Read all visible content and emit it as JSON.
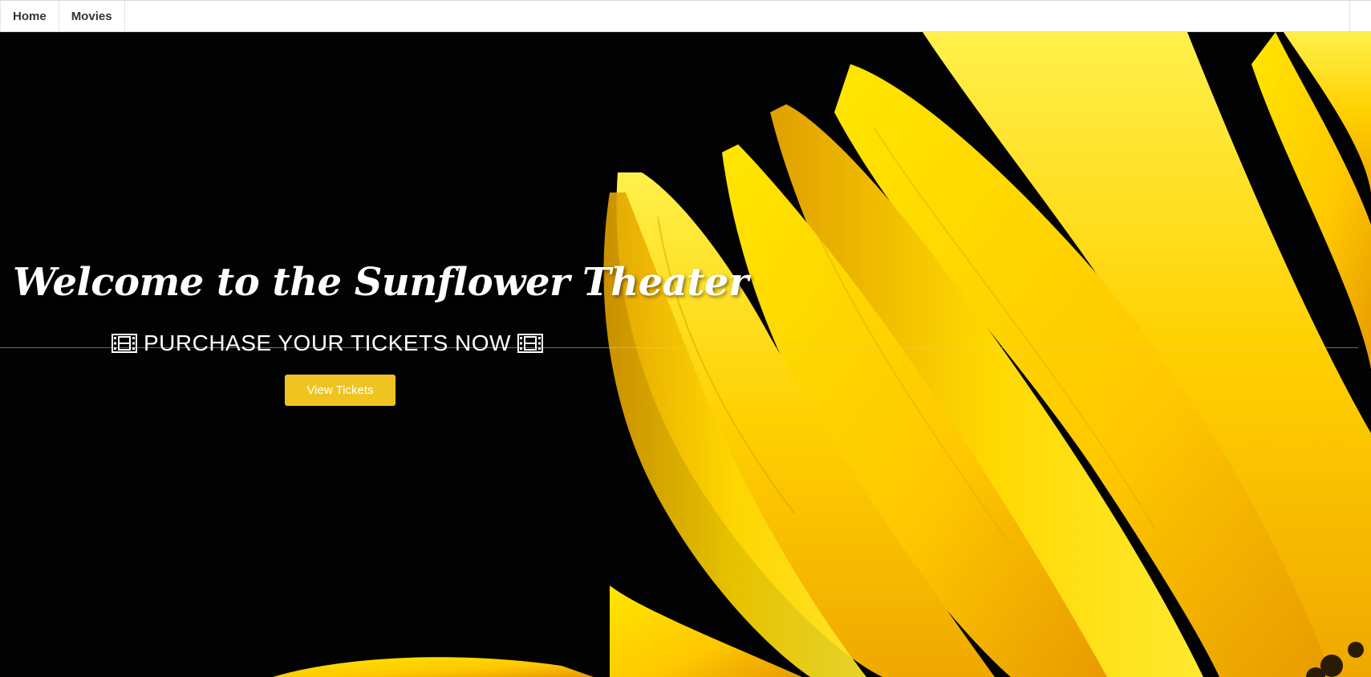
{
  "nav": {
    "items": [
      {
        "label": "Home"
      },
      {
        "label": "Movies"
      }
    ]
  },
  "hero": {
    "title": "Welcome to the Sunflower Theater",
    "subtitle": "PURCHASE YOUR TICKETS NOW",
    "button_label": "View Tickets",
    "left_icon": "film-icon",
    "right_icon": "film-icon",
    "background_image": "sunflower-petals-photo"
  },
  "colors": {
    "accent": "#f0c420",
    "hero_background": "#000000",
    "petal_yellow": "#ffd400",
    "nav_background": "#ffffff"
  }
}
